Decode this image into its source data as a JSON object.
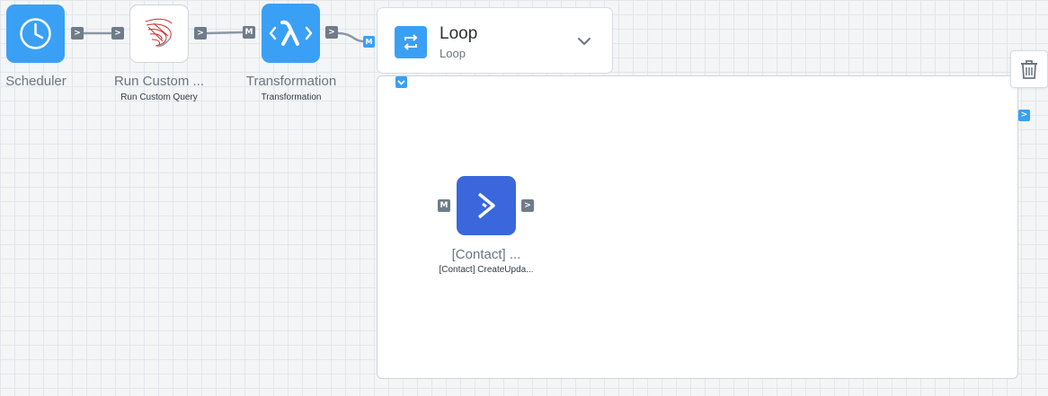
{
  "canvas": {
    "grid_color": "#e3e6ea",
    "background": "#f4f5f7",
    "wire_color": "#8a96a3"
  },
  "nodes": {
    "scheduler": {
      "title": "Scheduler",
      "icon": "clock-icon",
      "color": "#3aa0f5"
    },
    "run_custom_query": {
      "title": "Run Custom ...",
      "subtitle": "Run Custom Query",
      "icon": "sql-server-icon"
    },
    "transformation": {
      "title": "Transformation",
      "subtitle": "Transformation",
      "icon": "lambda-icon",
      "color": "#3aa0f5"
    },
    "contact": {
      "title": "[Contact] ...",
      "subtitle": "[Contact] CreateUpda...",
      "icon": "activecampaign-icon",
      "color": "#3a67dc"
    }
  },
  "loop": {
    "title": "Loop",
    "subtitle": "Loop",
    "icon": "loop-icon",
    "dropdown_icon": "chevron-down-icon"
  },
  "ports": {
    "output_glyph": ">",
    "map_glyph": "M",
    "loop_inner_glyph": "v"
  },
  "toolbar": {
    "delete_icon": "trash-icon"
  }
}
